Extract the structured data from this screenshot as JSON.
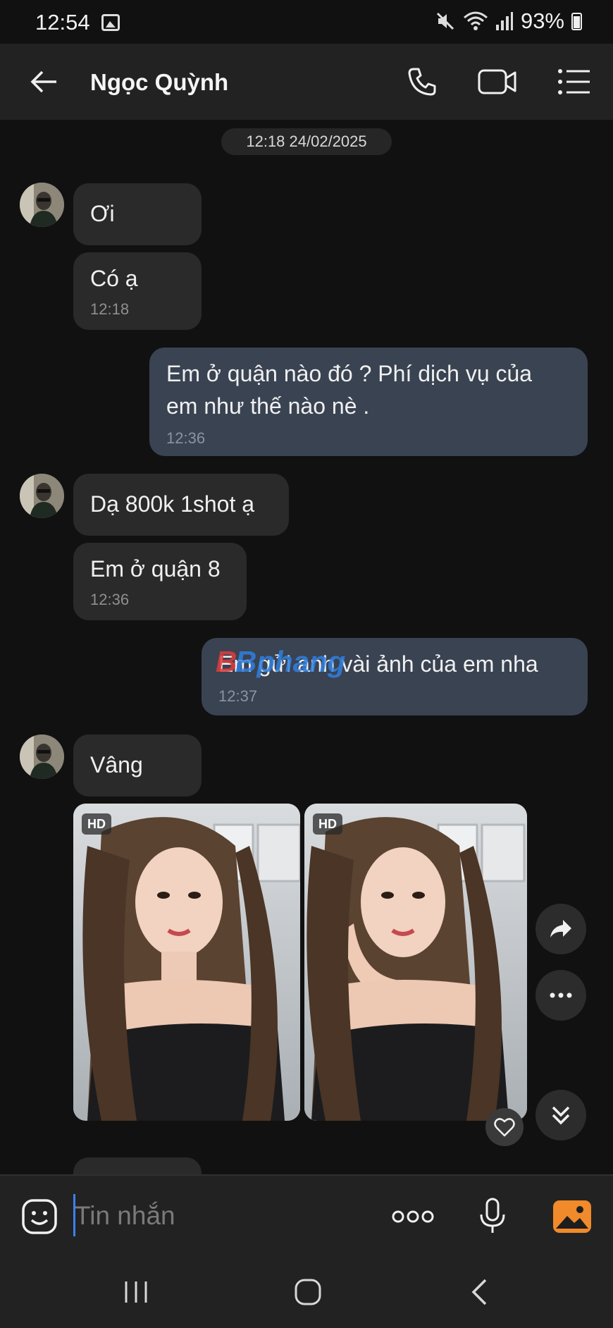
{
  "status_bar": {
    "time": "12:54",
    "battery": "93%"
  },
  "header": {
    "contact_name": "Ngọc Quỳnh"
  },
  "chat": {
    "date_separator": "12:18 24/02/2025",
    "messages": [
      {
        "direction": "incoming",
        "text": "Ơi",
        "time": ""
      },
      {
        "direction": "incoming",
        "text": "Có ạ",
        "time": "12:18"
      },
      {
        "direction": "outgoing",
        "lines": [
          "Em ở quận nào đó ? Phí dịch vụ của",
          "em như thế nào nè ."
        ],
        "time": "12:36"
      },
      {
        "direction": "incoming",
        "text": "Dạ 800k 1shot ạ",
        "time": ""
      },
      {
        "direction": "incoming",
        "text": "Em ở quận 8",
        "time": "12:36"
      },
      {
        "direction": "outgoing",
        "text": "Em gửi anh vài ảnh của em nha",
        "time": "12:37"
      },
      {
        "direction": "incoming",
        "text": "Vâng",
        "time": ""
      }
    ],
    "photos": [
      {
        "badge": "HD"
      },
      {
        "badge": "HD"
      }
    ],
    "watermark": "Bphang"
  },
  "input": {
    "placeholder": "Tin nhắn"
  },
  "colors": {
    "background": "#111111",
    "bar": "#222222",
    "incoming_bubble": "#2a2a2a",
    "outgoing_bubble": "#3a4352",
    "accent": "#3b82f6"
  },
  "icons": [
    "back-arrow-icon",
    "phone-icon",
    "video-call-icon",
    "menu-list-icon",
    "forward-icon",
    "more-icon",
    "scroll-down-icon",
    "heart-icon",
    "sticker-icon",
    "more-options-icon",
    "microphone-icon",
    "gallery-icon",
    "recents-icon",
    "home-icon",
    "back-icon"
  ]
}
